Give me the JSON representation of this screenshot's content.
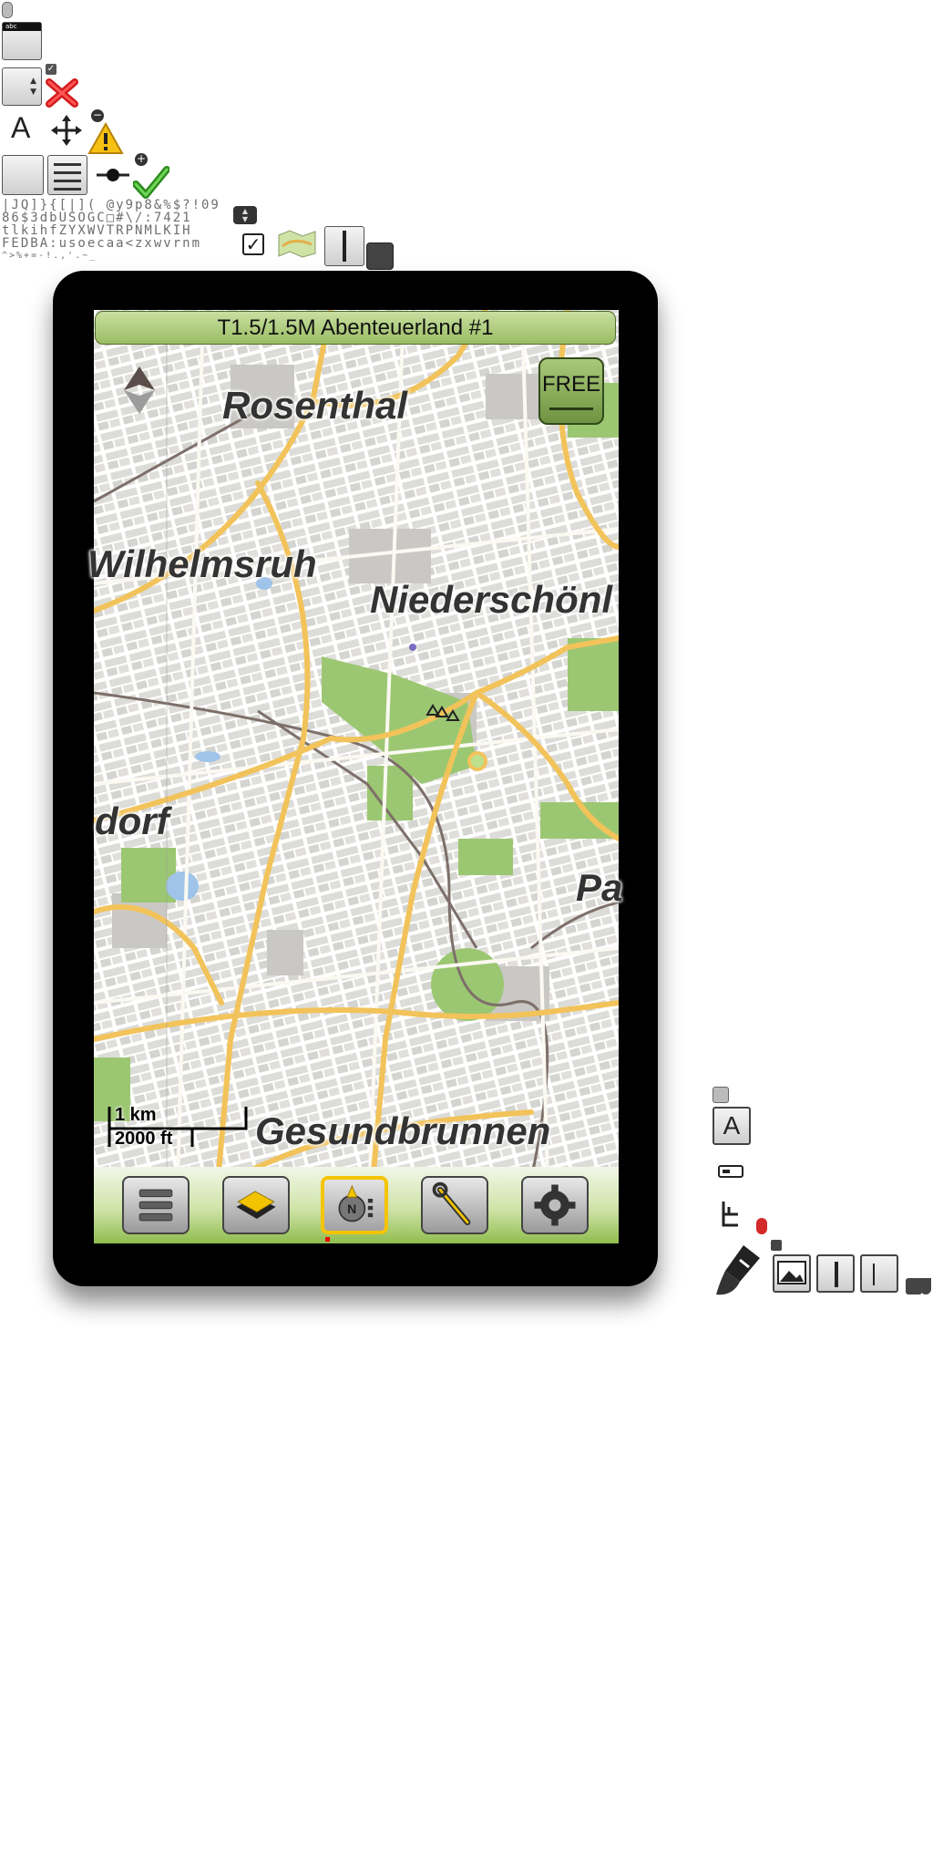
{
  "sprites": {
    "glyph_rows": [
      "|JQ]}{[|]( @y9p8&%$?!09",
      "86$3dbUSOGC□#\\/:7421",
      "tlkihfZYXWVTRPNMLKIH",
      "FEDBA:usoecaa<zxwvrnm",
      "^>%+=-!.,'.~_ "
    ],
    "font_sample_letter": "A",
    "font_sample_letter_2": "A",
    "edit_tag": "abc"
  },
  "app": {
    "title": "T1.5/1.5M Abenteuerland #1",
    "free_label": "FREE",
    "scale_km": "1 km",
    "scale_ft": "2000 ft"
  },
  "map": {
    "places": [
      {
        "id": "rosenthal",
        "name": "Rosenthal"
      },
      {
        "id": "wilhelmsruh",
        "name": "Wilhelmsruh"
      },
      {
        "id": "niederschoenh",
        "name": "Niederschönl"
      },
      {
        "id": "dorf",
        "name": "dorf"
      },
      {
        "id": "pa",
        "name": "Pa"
      },
      {
        "id": "gesundbrunnen",
        "name": "Gesundbrunnen"
      }
    ]
  },
  "bottom_nav": [
    {
      "id": "menu",
      "icon": "menu-icon"
    },
    {
      "id": "maps",
      "icon": "map-layers-icon"
    },
    {
      "id": "compass",
      "icon": "compass-navigation-icon"
    },
    {
      "id": "tools",
      "icon": "tools-icon"
    },
    {
      "id": "settings",
      "icon": "gear-icon"
    }
  ],
  "colors": {
    "title_bar": "#b2cf84",
    "road_major": "#f2c35a",
    "park": "#8cc264",
    "water": "#9fc3e9",
    "accent_active": "#f5c400"
  }
}
